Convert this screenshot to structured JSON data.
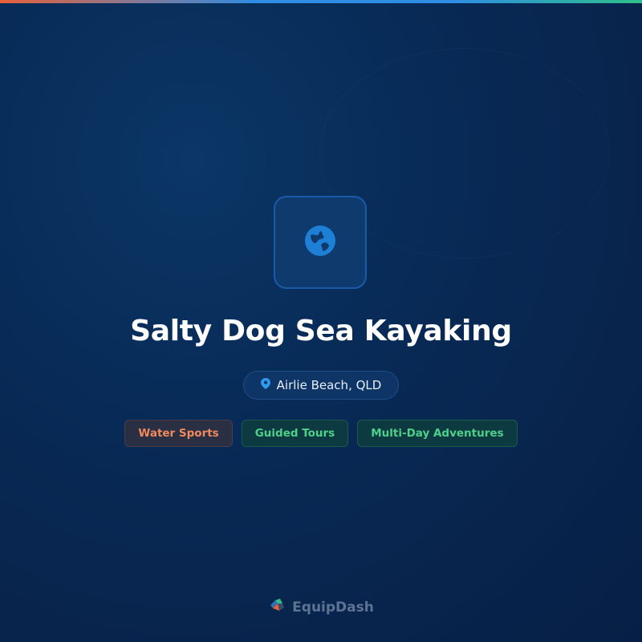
{
  "listing": {
    "title": "Salty Dog Sea Kayaking",
    "location": "Airlie Beach, QLD",
    "icon": "globe-icon"
  },
  "categories": [
    {
      "label": "Water Sports",
      "color": "#f08a5d"
    },
    {
      "label": "Guided Tours",
      "color": "#4fd08a"
    },
    {
      "label": "Multi-Day Adventures",
      "color": "#4fd08a"
    }
  ],
  "brand": {
    "name": "EquipDash",
    "icon": "equipdash-logo-icon"
  },
  "colors": {
    "background": "#082a56",
    "accent": "#2f8de4",
    "top_bar_start": "#e8613a",
    "top_bar_end": "#2fbf8a"
  }
}
